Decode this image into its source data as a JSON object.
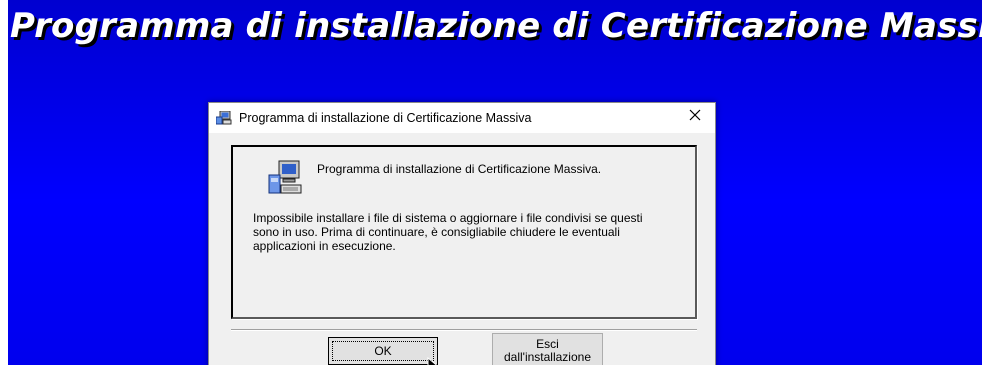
{
  "banner": {
    "title": "Programma di installazione di Certificazione Massiva"
  },
  "dialog": {
    "title": "Programma di installazione di Certificazione Massiva",
    "close_icon": "close-icon",
    "heading": "Programma di installazione di Certificazione Massiva.",
    "message_lines": [
      "Impossibile installare i file di sistema o aggiornare i file condivisi se questi",
      "sono in uso. Prima di continuare, è consigliabile chiudere le eventuali",
      "applicazioni in esecuzione."
    ],
    "buttons": {
      "ok_label": "OK",
      "exit_label_line1": "Esci",
      "exit_label_line2": "dall'installazione"
    }
  },
  "colors": {
    "desktop_top": "#0000d0",
    "desktop_bottom": "#0000ff",
    "banner_text": "#ffffff",
    "banner_shadow": "#000000"
  }
}
